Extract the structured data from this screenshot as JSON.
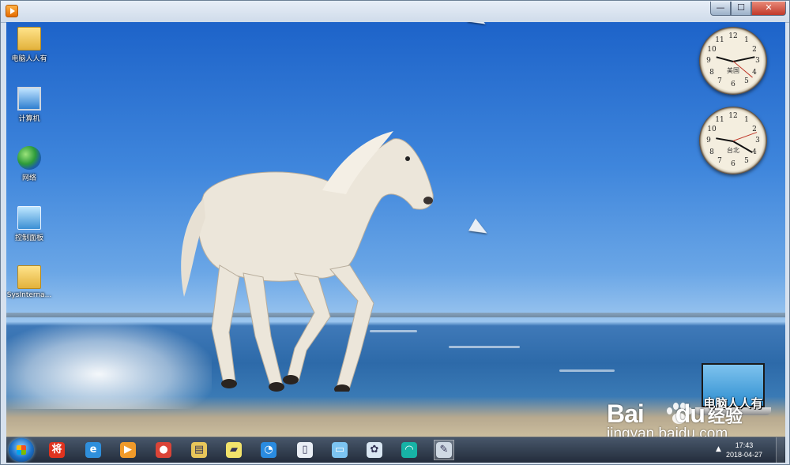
{
  "window": {
    "minimize_glyph": "—",
    "maximize_glyph": "☐",
    "close_glyph": "✕",
    "app_icon": "media-player-icon"
  },
  "desktop": {
    "icons": [
      {
        "label": "电脑人人有",
        "icon": "user-folder-icon"
      },
      {
        "label": "计算机",
        "icon": "computer-icon"
      },
      {
        "label": "网络",
        "icon": "network-icon"
      },
      {
        "label": "控制面板",
        "icon": "control-panel-icon"
      },
      {
        "label": "SysInterna...",
        "icon": "folder-icon"
      }
    ]
  },
  "gadgets": {
    "clocks": [
      {
        "city": "美国",
        "numerals": [
          "12",
          "1",
          "2",
          "3",
          "4",
          "5",
          "6",
          "7",
          "8",
          "9",
          "10",
          "11"
        ]
      },
      {
        "city": "台北",
        "numerals": [
          "12",
          "1",
          "2",
          "3",
          "4",
          "5",
          "6",
          "7",
          "8",
          "9",
          "10",
          "11"
        ]
      }
    ]
  },
  "watermark": {
    "baidu": "Bai",
    "du": "du",
    "jingyan": "经验",
    "url": "jingyan.baidu.com"
  },
  "laptop_logo": {
    "caption": "电脑人人有"
  },
  "taskbar": {
    "pinned": [
      {
        "name": "start-button"
      },
      {
        "name": "jiang-app-icon",
        "color": "#e0331f",
        "glyph": "将"
      },
      {
        "name": "internet-explorer-icon",
        "color": "#2f8fdc",
        "glyph": "e"
      },
      {
        "name": "media-player-icon",
        "color": "#f09a2a",
        "glyph": "▶"
      },
      {
        "name": "chrome-icon",
        "color": "#db4437",
        "glyph": "●"
      },
      {
        "name": "file-explorer-icon",
        "color": "#e8c65a",
        "glyph": "▤"
      },
      {
        "name": "sticky-notes-icon",
        "color": "#f2e36b",
        "glyph": "▰"
      },
      {
        "name": "browser-icon",
        "color": "#2a8be0",
        "glyph": "◔"
      },
      {
        "name": "document-icon",
        "color": "#e9eef5",
        "glyph": "▯"
      },
      {
        "name": "remote-desktop-icon",
        "color": "#7cc4f2",
        "glyph": "▭"
      },
      {
        "name": "settings-gear-icon",
        "color": "#d9e6f2",
        "glyph": "✿"
      },
      {
        "name": "headset-app-icon",
        "color": "#17b3a6",
        "glyph": "◠"
      },
      {
        "name": "paint-app-icon",
        "color": "#cfd9e4",
        "glyph": "✎",
        "active": true
      }
    ],
    "tray_arrow": "▲",
    "time": "17:43",
    "date": "2018-04-27"
  }
}
